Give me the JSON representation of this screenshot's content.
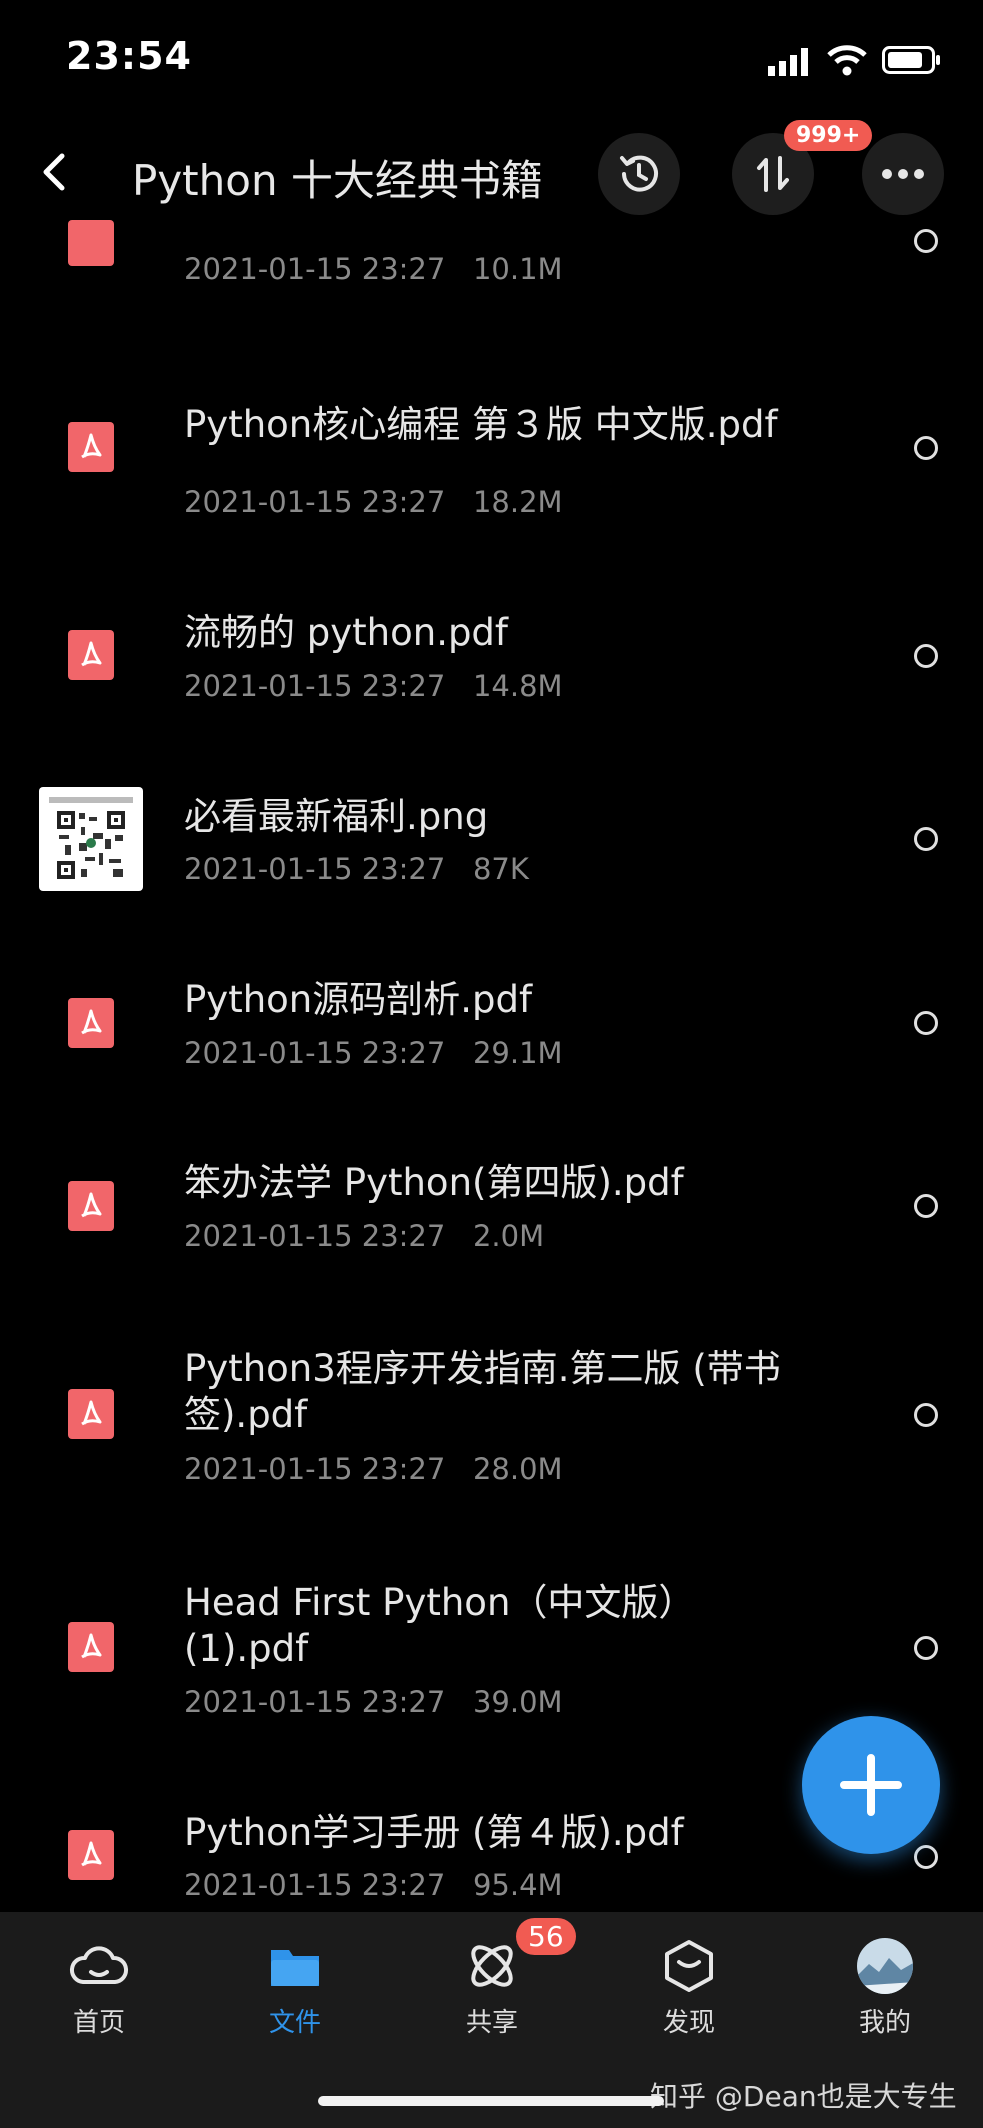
{
  "status": {
    "time": "23:54"
  },
  "header": {
    "title": "Python 十大经典书籍",
    "transfer_badge": "999+"
  },
  "files": [
    {
      "name": "",
      "date": "2021-01-15 23:27",
      "size": "10.1M",
      "type": "pdf"
    },
    {
      "name": "Python核心编程 第３版 中文版.pdf",
      "date": "2021-01-15 23:27",
      "size": "18.2M",
      "type": "pdf"
    },
    {
      "name": "流畅的 python.pdf",
      "date": "2021-01-15 23:27",
      "size": "14.8M",
      "type": "pdf"
    },
    {
      "name": "必看最新福利.png",
      "date": "2021-01-15 23:27",
      "size": "87K",
      "type": "png"
    },
    {
      "name": "Python源码剖析.pdf",
      "date": "2021-01-15 23:27",
      "size": "29.1M",
      "type": "pdf"
    },
    {
      "name": "笨办法学 Python(第四版).pdf",
      "date": "2021-01-15 23:27",
      "size": "2.0M",
      "type": "pdf"
    },
    {
      "name": "Python3程序开发指南.第二版 (带书签).pdf",
      "date": "2021-01-15 23:27",
      "size": "28.0M",
      "type": "pdf"
    },
    {
      "name": "Head First Python（中文版）(1).pdf",
      "date": "2021-01-15 23:27",
      "size": "39.0M",
      "type": "pdf"
    },
    {
      "name": "Python学习手册 (第４版).pdf",
      "date": "2021-01-15 23:27",
      "size": "95.4M",
      "type": "pdf"
    }
  ],
  "nav": {
    "items": [
      {
        "label": "首页",
        "icon": "cloud-icon"
      },
      {
        "label": "文件",
        "icon": "folder-icon",
        "active": true
      },
      {
        "label": "共享",
        "icon": "share-icon",
        "badge": "56"
      },
      {
        "label": "发现",
        "icon": "discover-icon"
      },
      {
        "label": "我的",
        "icon": "avatar-icon"
      }
    ]
  },
  "watermark": "知乎 @Dean也是大专生",
  "colors": {
    "accent": "#2f93ea",
    "badge": "#f15b52",
    "pdf": "#f1666a"
  }
}
